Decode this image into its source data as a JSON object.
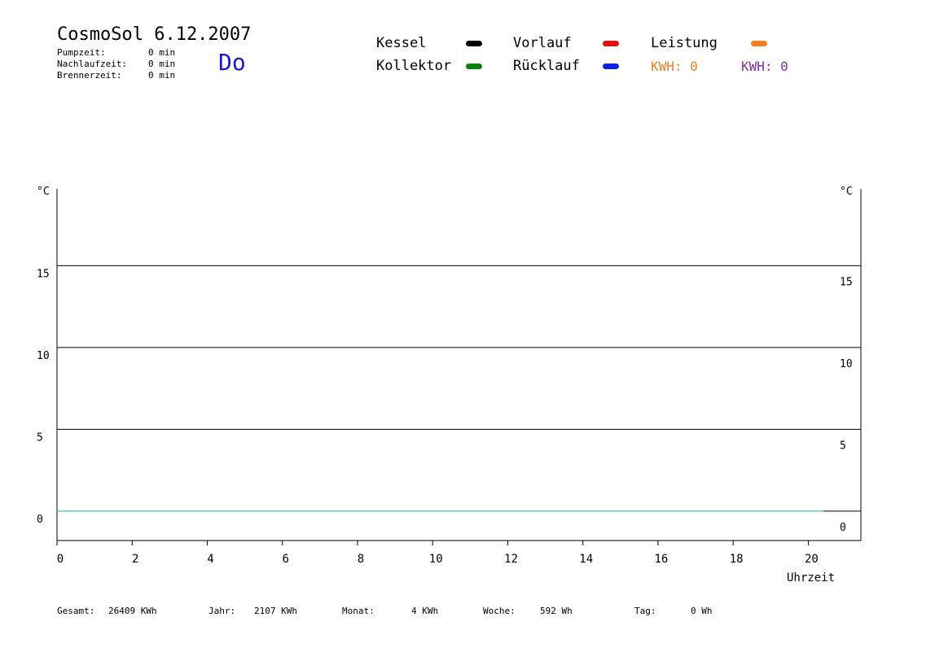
{
  "header": {
    "title": "CosmoSol 6.12.2007",
    "day": "Do",
    "stats": [
      {
        "label": "Pumpzeit:",
        "value": "0 min"
      },
      {
        "label": "Nachlaufzeit:",
        "value": "0 min"
      },
      {
        "label": "Brennerzeit:",
        "value": "0 min"
      }
    ]
  },
  "legend": {
    "items": [
      {
        "label": "Kessel",
        "color": "#000000"
      },
      {
        "label": "Vorlauf",
        "color": "#e01010"
      },
      {
        "label": "Leistung",
        "color": "#f08020"
      },
      {
        "label": "Kollektor",
        "color": "#108010"
      },
      {
        "label": "Rücklauf",
        "color": "#1020e0"
      }
    ],
    "kwh_orange": "KWH: 0",
    "kwh_purple": "KWH: 0",
    "kwh_orange_color": "#f08020",
    "kwh_purple_color": "#8030a0"
  },
  "chart_data": {
    "type": "line",
    "y_unit_left": "°C",
    "y_unit_right": "°C",
    "xlabel": "Uhrzeit",
    "x_ticks": [
      0,
      2,
      4,
      6,
      8,
      10,
      12,
      14,
      16,
      18,
      20
    ],
    "y_ticks": [
      0,
      5,
      10,
      15
    ],
    "xlim": [
      0,
      21.4
    ],
    "ylim": [
      -1.8,
      19.7
    ],
    "grid": "horizontal",
    "series": [
      {
        "color": "#40e0d0",
        "x": [
          0,
          20.4
        ],
        "y": [
          0,
          0
        ]
      }
    ]
  },
  "footer": [
    {
      "label": "Gesamt:",
      "value": "26409 KWh"
    },
    {
      "label": "Jahr:",
      "value": "2107 KWh"
    },
    {
      "label": "Monat:",
      "value": "4 KWh"
    },
    {
      "label": "Woche:",
      "value": "592 Wh"
    },
    {
      "label": "Tag:",
      "value": "0 Wh"
    }
  ]
}
